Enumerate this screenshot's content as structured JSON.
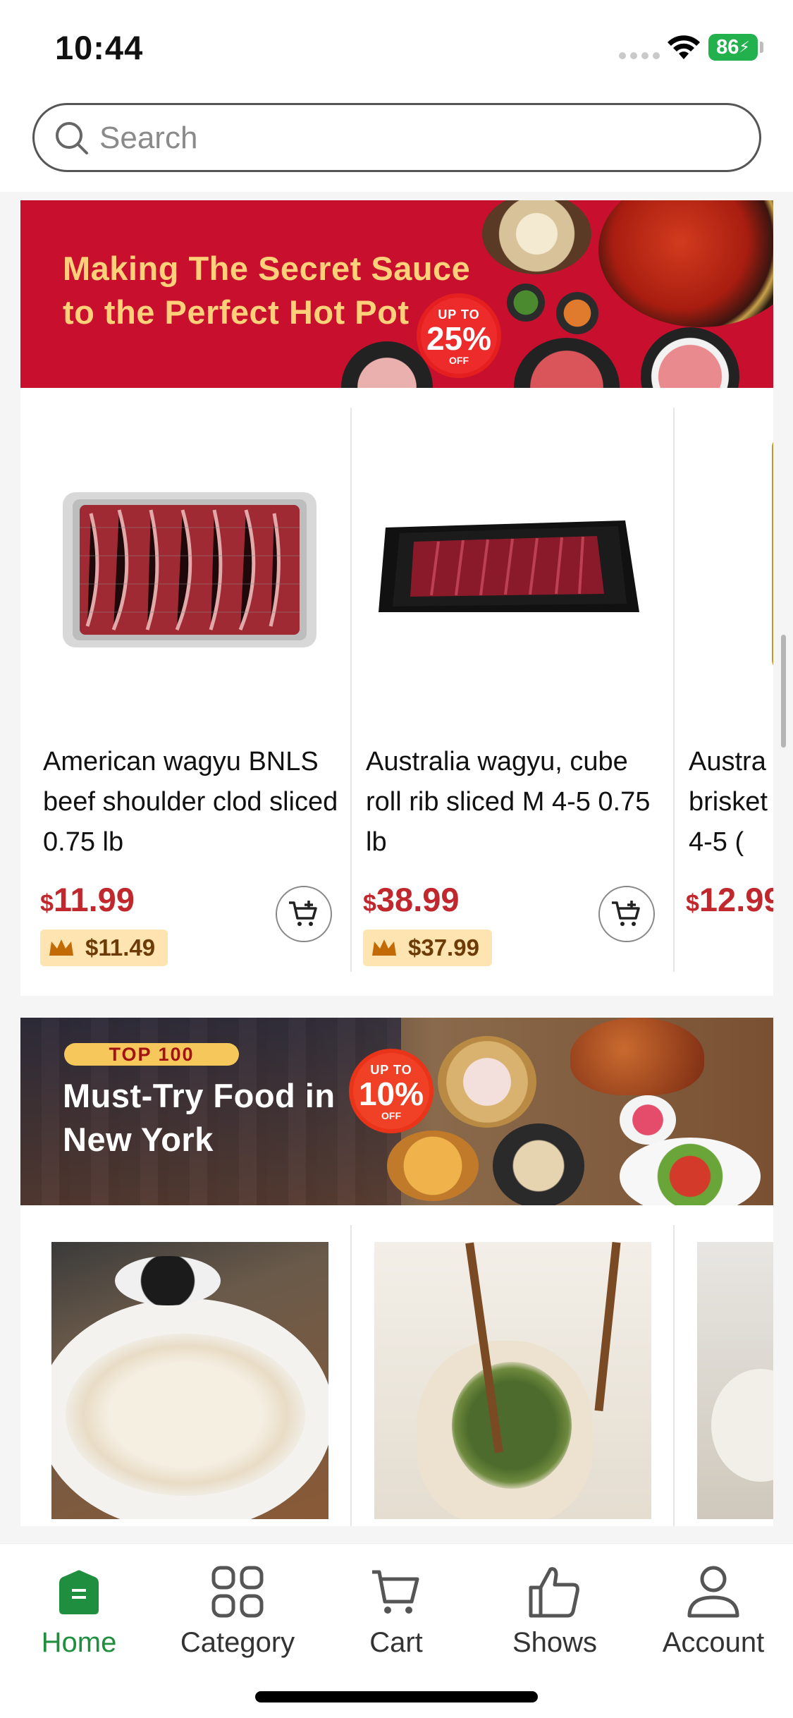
{
  "status_bar": {
    "time": "10:44",
    "battery": "86"
  },
  "search": {
    "placeholder": "Search"
  },
  "banners": [
    {
      "line1": "Making The Secret Sauce",
      "line2": "to the Perfect Hot Pot",
      "badge_top": "UP TO",
      "badge_pct": "25%",
      "badge_off": "OFF"
    },
    {
      "pill": "TOP 100",
      "line1": "Must-Try Food in",
      "line2": "New York",
      "badge_top": "UP TO",
      "badge_pct": "10%",
      "badge_off": "OFF"
    }
  ],
  "products": [
    {
      "name": "American wagyu BNLS beef shoulder clod sliced 0.75 lb",
      "currency": "$",
      "price": "11.99",
      "member_price": "$11.49"
    },
    {
      "name": "Australia wagyu, cube roll rib sliced M 4-5 0.75 lb",
      "currency": "$",
      "price": "38.99",
      "member_price": "$37.99"
    },
    {
      "name": "Austra brisket M 4-5 (",
      "currency": "$",
      "price": "12.99"
    }
  ],
  "tabs": [
    {
      "label": "Home",
      "icon": "home-icon",
      "active": true
    },
    {
      "label": "Category",
      "icon": "category-icon"
    },
    {
      "label": "Cart",
      "icon": "cart-icon"
    },
    {
      "label": "Shows",
      "icon": "thumbs-up-icon"
    },
    {
      "label": "Account",
      "icon": "account-icon"
    }
  ],
  "colors": {
    "accent": "#1f8f3f",
    "price": "#c0282d",
    "banner_red": "#c8102e"
  }
}
